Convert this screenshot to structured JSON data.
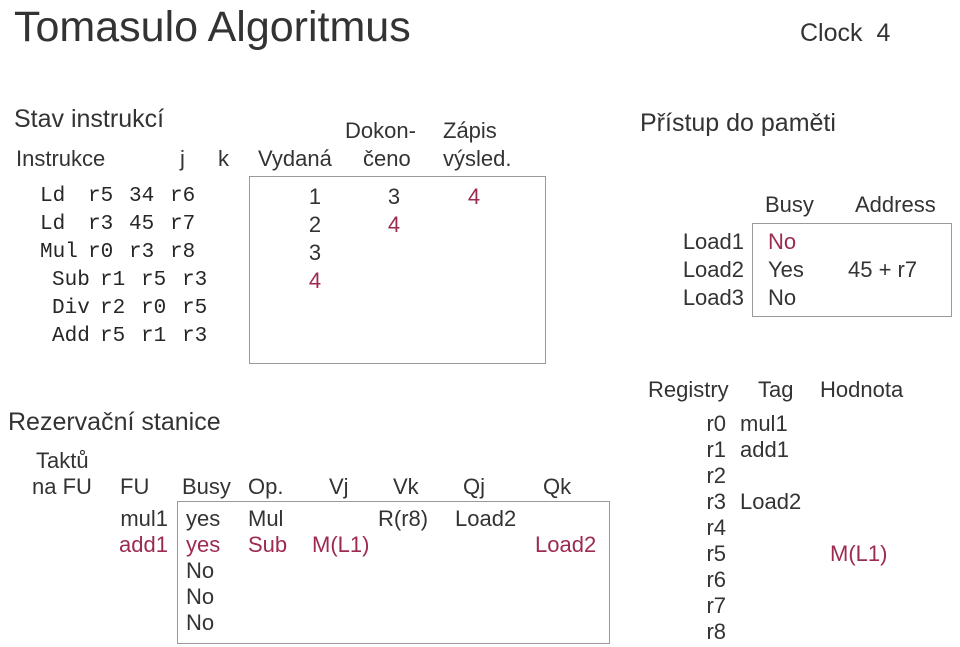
{
  "slide": {
    "title": "Tomasulo Algoritmus",
    "clock_label": "Clock",
    "clock_value": "4"
  },
  "colors": {
    "text": "#333333",
    "highlight": "#9C2B50",
    "border": "#9A9A9A"
  },
  "instruction_status": {
    "heading": "Stav instrukcí",
    "headers": {
      "instrukce": "Instrukce",
      "j": "j",
      "k": "k",
      "vydana": "Vydaná",
      "dokonceno_line1": "Dokon-",
      "dokonceno_line2": "čeno",
      "zapis_line1": "Zápis",
      "zapis_line2": "výsled."
    },
    "rows": [
      {
        "op": "Ld",
        "dest": "r5",
        "j": "34",
        "k": "r6",
        "issue": "1",
        "issue_hot": false,
        "exec": "3",
        "exec_hot": false,
        "write": "4",
        "write_hot": true
      },
      {
        "op": "Ld",
        "dest": "r3",
        "j": "45",
        "k": "r7",
        "issue": "2",
        "issue_hot": false,
        "exec": "4",
        "exec_hot": true,
        "write": "",
        "write_hot": false
      },
      {
        "op": "Mul",
        "dest": "r0",
        "j": "r3",
        "k": "r8",
        "issue": "3",
        "issue_hot": false,
        "exec": "",
        "exec_hot": false,
        "write": "",
        "write_hot": false
      },
      {
        "op": "Sub",
        "dest": "r1",
        "j": "r5",
        "k": "r3",
        "issue": "4",
        "issue_hot": true,
        "exec": "",
        "exec_hot": false,
        "write": "",
        "write_hot": false
      },
      {
        "op": "Div",
        "dest": "r2",
        "j": "r0",
        "k": "r5",
        "issue": "",
        "issue_hot": false,
        "exec": "",
        "exec_hot": false,
        "write": "",
        "write_hot": false
      },
      {
        "op": "Add",
        "dest": "r5",
        "j": "r1",
        "k": "r3",
        "issue": "",
        "issue_hot": false,
        "exec": "",
        "exec_hot": false,
        "write": "",
        "write_hot": false
      }
    ]
  },
  "memory_access": {
    "heading": "Přístup do paměti",
    "headers": {
      "busy": "Busy",
      "address": "Address"
    },
    "rows": [
      {
        "name": "Load1",
        "busy": "No",
        "busy_hot": true,
        "address": "",
        "address_hot": false
      },
      {
        "name": "Load2",
        "busy": "Yes",
        "busy_hot": false,
        "address": "45 + r7",
        "address_hot": false
      },
      {
        "name": "Load3",
        "busy": "No",
        "busy_hot": false,
        "address": "",
        "address_hot": false
      }
    ]
  },
  "reservation_stations": {
    "heading": "Rezervační stanice",
    "headers": {
      "taktu_line1": "Taktů",
      "taktu_line2": "na FU",
      "fu": "FU",
      "busy": "Busy",
      "op": "Op.",
      "vj": "Vj",
      "vk": "Vk",
      "qj": "Qj",
      "qk": "Qk"
    },
    "rows": [
      {
        "ticks": "",
        "fu": "mul1",
        "fu_hot": false,
        "busy": "yes",
        "op": "Mul",
        "vj": "",
        "vk": "R(r8)",
        "qj": "Load2",
        "qk": "",
        "hot": false
      },
      {
        "ticks": "",
        "fu": "add1",
        "fu_hot": true,
        "busy": "yes",
        "op": "Sub",
        "vj": "M(L1)",
        "vk": "",
        "qj": "",
        "qk": "Load2",
        "hot": true
      },
      {
        "ticks": "",
        "fu": "",
        "fu_hot": false,
        "busy": "No",
        "op": "",
        "vj": "",
        "vk": "",
        "qj": "",
        "qk": "",
        "hot": false
      },
      {
        "ticks": "",
        "fu": "",
        "fu_hot": false,
        "busy": "No",
        "op": "",
        "vj": "",
        "vk": "",
        "qj": "",
        "qk": "",
        "hot": false
      },
      {
        "ticks": "",
        "fu": "",
        "fu_hot": false,
        "busy": "No",
        "op": "",
        "vj": "",
        "vk": "",
        "qj": "",
        "qk": "",
        "hot": false
      }
    ]
  },
  "register_status": {
    "headers": {
      "registry": "Registry",
      "tag": "Tag",
      "hodnota": "Hodnota"
    },
    "rows": [
      {
        "name": "r0",
        "tag": "mul1",
        "value": "",
        "tag_hot": false,
        "value_hot": false
      },
      {
        "name": "r1",
        "tag": "add1",
        "value": "",
        "tag_hot": false,
        "value_hot": false
      },
      {
        "name": "r2",
        "tag": "",
        "value": "",
        "tag_hot": false,
        "value_hot": false
      },
      {
        "name": "r3",
        "tag": "Load2",
        "value": "",
        "tag_hot": false,
        "value_hot": false
      },
      {
        "name": "r4",
        "tag": "",
        "value": "",
        "tag_hot": false,
        "value_hot": false
      },
      {
        "name": "r5",
        "tag": "",
        "value": "M(L1)",
        "tag_hot": false,
        "value_hot": true
      },
      {
        "name": "r6",
        "tag": "",
        "value": "",
        "tag_hot": false,
        "value_hot": false
      },
      {
        "name": "r7",
        "tag": "",
        "value": "",
        "tag_hot": false,
        "value_hot": false
      },
      {
        "name": "r8",
        "tag": "",
        "value": "",
        "tag_hot": false,
        "value_hot": false
      }
    ]
  }
}
